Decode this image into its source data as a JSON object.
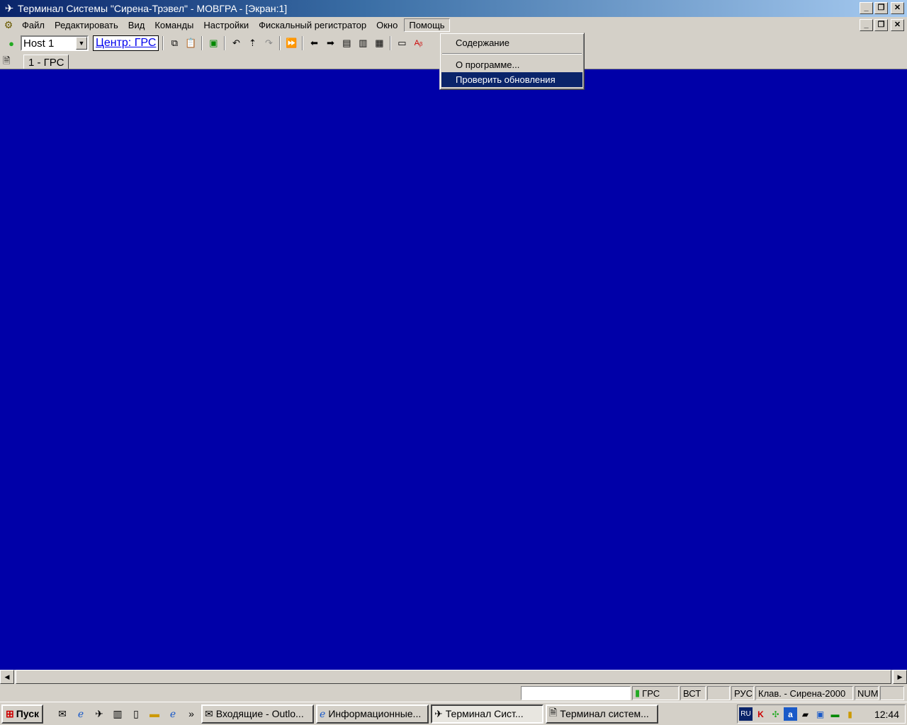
{
  "window": {
    "title": "Терминал Системы \"Сирена-Трэвел\" - MOBГPA - [Экран:1]",
    "app_icon": "airplane-icon"
  },
  "menu": {
    "items": [
      "Файл",
      "Редактировать",
      "Вид",
      "Команды",
      "Настройки",
      "Фискальный регистратор",
      "Окно",
      "Помощь"
    ],
    "active": "Помощь"
  },
  "help_menu": {
    "items": [
      "Содержание",
      "О программе...",
      "Проверить обновления"
    ],
    "highlighted": "Проверить обновления"
  },
  "toolbar": {
    "host": "Host 1",
    "center": "Центр: ГРС"
  },
  "tabs": [
    "1 - ГРС"
  ],
  "terminal": {
    "background": "#0000a8"
  },
  "statusbar": {
    "grs": "ГРС",
    "mode": "ВСТ",
    "lang": "РУС",
    "keyboard": "Клав. - Сирена-2000",
    "num": "NUM"
  },
  "taskbar": {
    "start": "Пуск",
    "tasks": [
      "Входящие - Outlo...",
      "Информационные...",
      "Терминал Сист...",
      "Терминал систем..."
    ],
    "active_task": "Терминал Сист...",
    "tray_lang": "RU",
    "clock": "12:44"
  }
}
